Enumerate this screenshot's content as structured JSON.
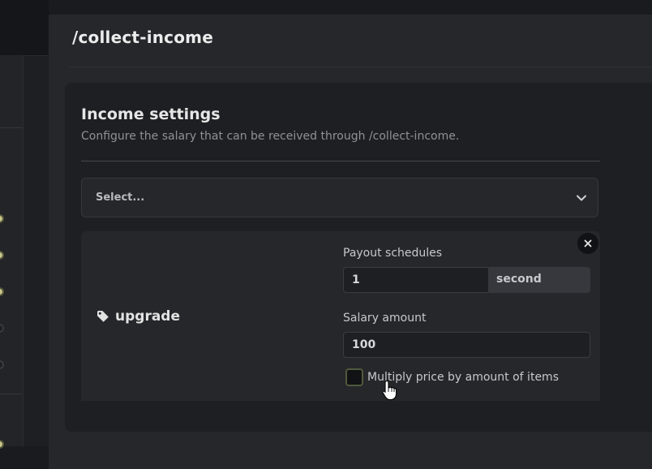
{
  "panel": {
    "title": "/collect-income"
  },
  "income_settings": {
    "title": "Income settings",
    "description": "Configure the salary that can be received through /collect-income."
  },
  "select": {
    "placeholder": "Select...",
    "icon": "chevron-down-icon"
  },
  "item": {
    "icon": "tag-icon",
    "name": "upgrade",
    "remove_icon": "close-icon",
    "payout_label": "Payout schedules",
    "payout_value": "1",
    "payout_unit": "second",
    "salary_label": "Salary amount",
    "salary_value": "100",
    "multiply_label": "Multiply price by amount of items",
    "multiply_checked": false
  },
  "colors": {
    "background": "#1a1b1e",
    "panel": "#26272b",
    "card": "#1e1f22",
    "text": "#e6e6e6",
    "muted": "#8e9196",
    "toggle_on": "#c8c68a"
  }
}
